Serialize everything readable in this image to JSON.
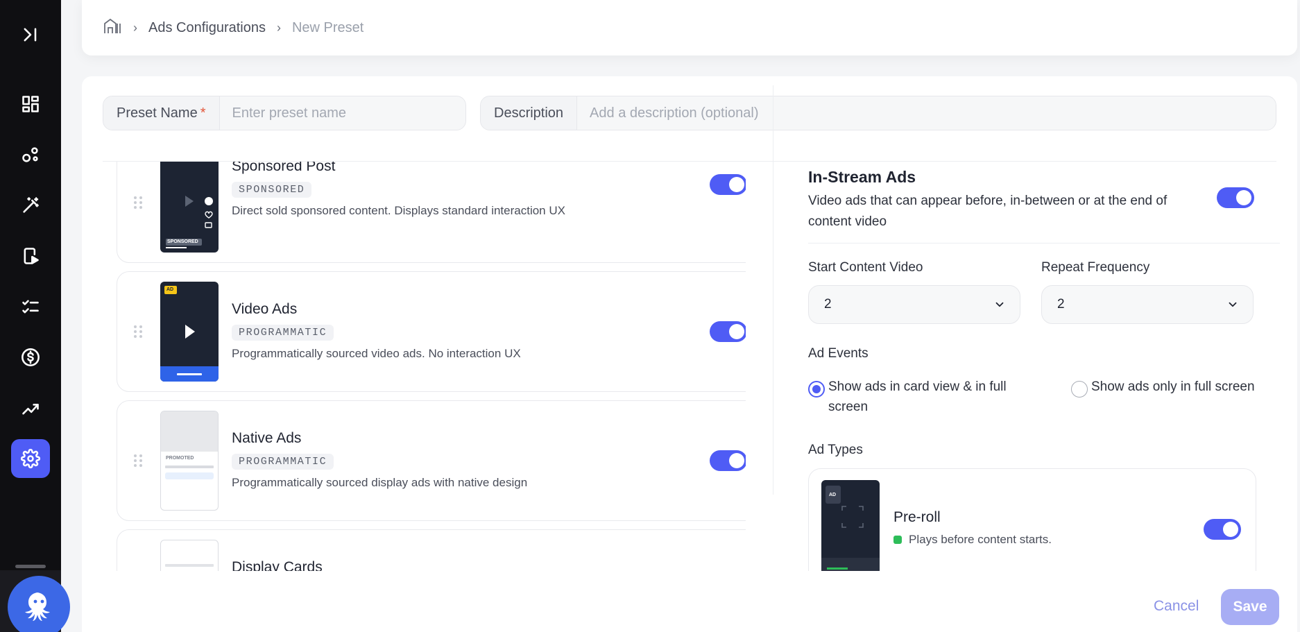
{
  "breadcrumb": {
    "items": [
      "Ads Configurations",
      "New Preset"
    ]
  },
  "form": {
    "preset_name_label": "Preset Name",
    "required_mark": "*",
    "preset_name_placeholder": "Enter preset name",
    "description_label": "Description",
    "description_placeholder": "Add a description (optional)"
  },
  "ad_list": [
    {
      "title": "Sponsored Post",
      "badge": "SPONSORED",
      "description": "Direct sold sponsored content. Displays standard interaction UX",
      "enabled": true,
      "thumb_label": "SPONSORED"
    },
    {
      "title": "Video Ads",
      "badge": "PROGRAMMATIC",
      "description": "Programmatically sourced video ads. No interaction UX",
      "enabled": true,
      "thumb_label": "AD"
    },
    {
      "title": "Native Ads",
      "badge": "PROGRAMMATIC",
      "description": "Programmatically sourced display ads with native design",
      "enabled": true,
      "thumb_label": "PROMOTED"
    },
    {
      "title": "Display Cards",
      "badge": "",
      "description": "",
      "enabled": true
    }
  ],
  "instream": {
    "title": "In-Stream Ads",
    "description": "Video ads that can appear before, in-between or at the end of content video",
    "enabled": true,
    "start_label": "Start Content Video",
    "start_value": "2",
    "repeat_label": "Repeat Frequency",
    "repeat_value": "2",
    "events_label": "Ad Events",
    "events_options": [
      {
        "label": "Show ads in card view & in full screen",
        "checked": true
      },
      {
        "label": "Show ads only in full screen",
        "checked": false
      }
    ],
    "types_label": "Ad Types",
    "types": [
      {
        "title": "Pre-roll",
        "description": "Plays before content starts.",
        "enabled": true,
        "thumb_label": "AD"
      }
    ]
  },
  "footer": {
    "cancel_label": "Cancel",
    "save_label": "Save"
  },
  "colors": {
    "accent": "#4f5cf5",
    "sidebar_bg": "#0f0f12",
    "status_green": "#2ebd59"
  },
  "sidebar_icons": [
    "expand-icon",
    "dashboard-icon",
    "nodes-icon",
    "magic-wand-icon",
    "video-device-icon",
    "checklist-icon",
    "dollar-icon",
    "trend-icon",
    "settings-icon"
  ]
}
